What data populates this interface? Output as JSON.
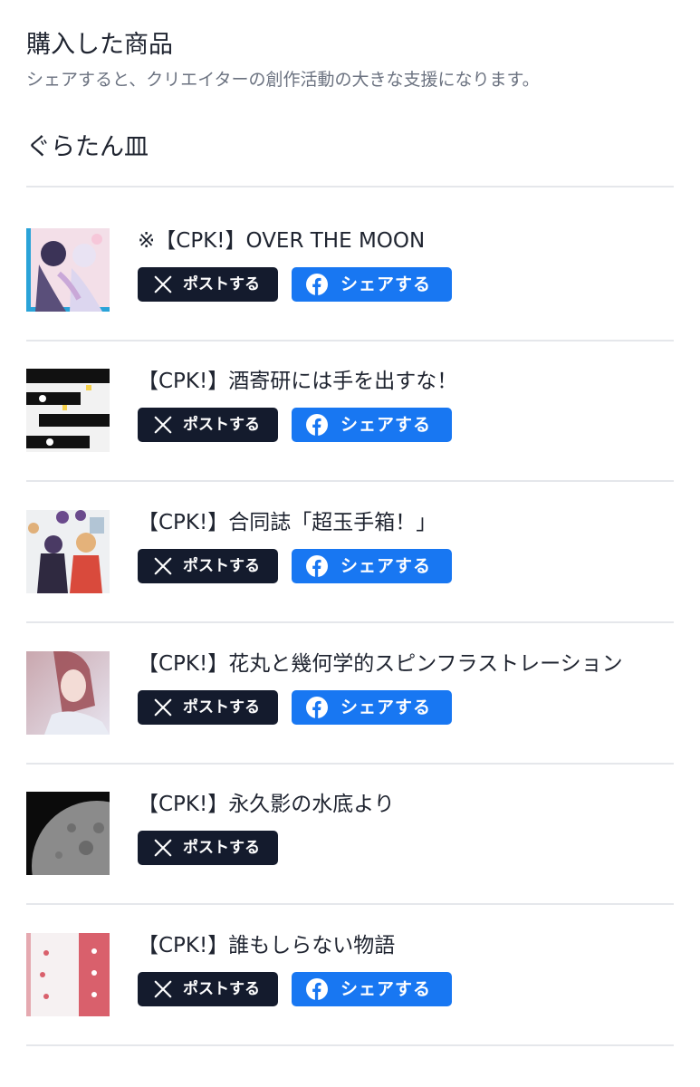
{
  "header": {
    "title": "購入した商品",
    "subtitle": "シェアすると、クリエイターの創作活動の大きな支援になります。"
  },
  "shop": {
    "name": "ぐらたん皿"
  },
  "buttons": {
    "x_post": "ポストする",
    "facebook_share": "シェアする"
  },
  "products": [
    {
      "title": "※【CPK!】OVER THE MOON",
      "has_facebook": true
    },
    {
      "title": "【CPK!】酒寄研には手を出すな！",
      "has_facebook": true
    },
    {
      "title": "【CPK!】合同誌「超玉手箱！」",
      "has_facebook": true
    },
    {
      "title": "【CPK!】花丸と幾何学的スピンフラストレーション",
      "has_facebook": true
    },
    {
      "title": "【CPK!】永久影の水底より",
      "has_facebook": false
    },
    {
      "title": "【CPK!】誰もしらない物語",
      "has_facebook": true
    }
  ],
  "colors": {
    "x_button": "#141b2d",
    "facebook_button": "#1877f2",
    "divider": "#e5e7eb"
  },
  "icons": {
    "x": "x-logo-icon",
    "facebook": "facebook-logo-icon"
  }
}
